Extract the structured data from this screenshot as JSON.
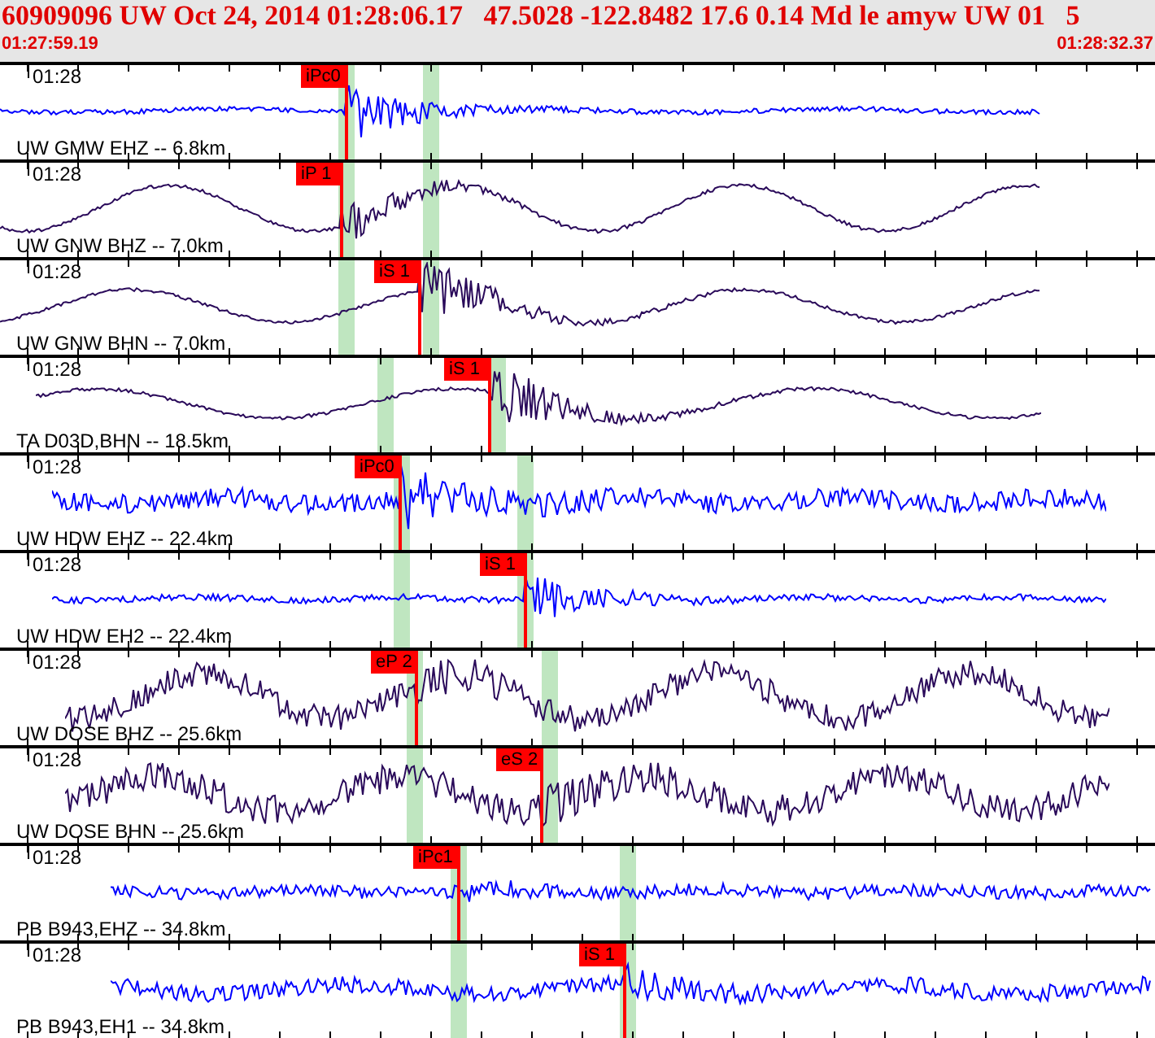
{
  "header": {
    "title": "60909096 UW Oct 24, 2014 01:28:06.17   47.5028 -122.8482 17.6 0.14 Md le amyw UW 01   5",
    "start_time": "01:27:59.19",
    "end_time": "01:28:32.37"
  },
  "traces": [
    {
      "time_label": "01:28",
      "station": "UW GMW EHZ -- 6.8km",
      "color": "#0000ff",
      "pick": "iPc0"
    },
    {
      "time_label": "01:28",
      "station": "UW GNW BHZ -- 7.0km",
      "color": "#2a0a5a",
      "pick": "iP 1"
    },
    {
      "time_label": "01:28",
      "station": "UW GNW BHN -- 7.0km",
      "color": "#2a0a5a",
      "pick": "iS 1"
    },
    {
      "time_label": "01:28",
      "station": "TA D03D,BHN -- 18.5km",
      "color": "#2a0a5a",
      "pick": "iS 1"
    },
    {
      "time_label": "01:28",
      "station": "UW HDW EHZ -- 22.4km",
      "color": "#0000ff",
      "pick": "iPc0"
    },
    {
      "time_label": "01:28",
      "station": "UW HDW EH2 -- 22.4km",
      "color": "#0000ff",
      "pick": "iS 1"
    },
    {
      "time_label": "01:28",
      "station": "UW DOSE BHZ -- 25.6km",
      "color": "#2a0a5a",
      "pick": "eP 2"
    },
    {
      "time_label": "01:28",
      "station": "UW DOSE BHN -- 25.6km",
      "color": "#2a0a5a",
      "pick": "eS 2"
    },
    {
      "time_label": "01:28",
      "station": "PB B943,EHZ -- 34.8km",
      "color": "#0000ff",
      "pick": "iPc1"
    },
    {
      "time_label": "01:28",
      "station": "PB B943,EH1 -- 34.8km",
      "color": "#0000ff",
      "pick": "iS 1"
    }
  ]
}
